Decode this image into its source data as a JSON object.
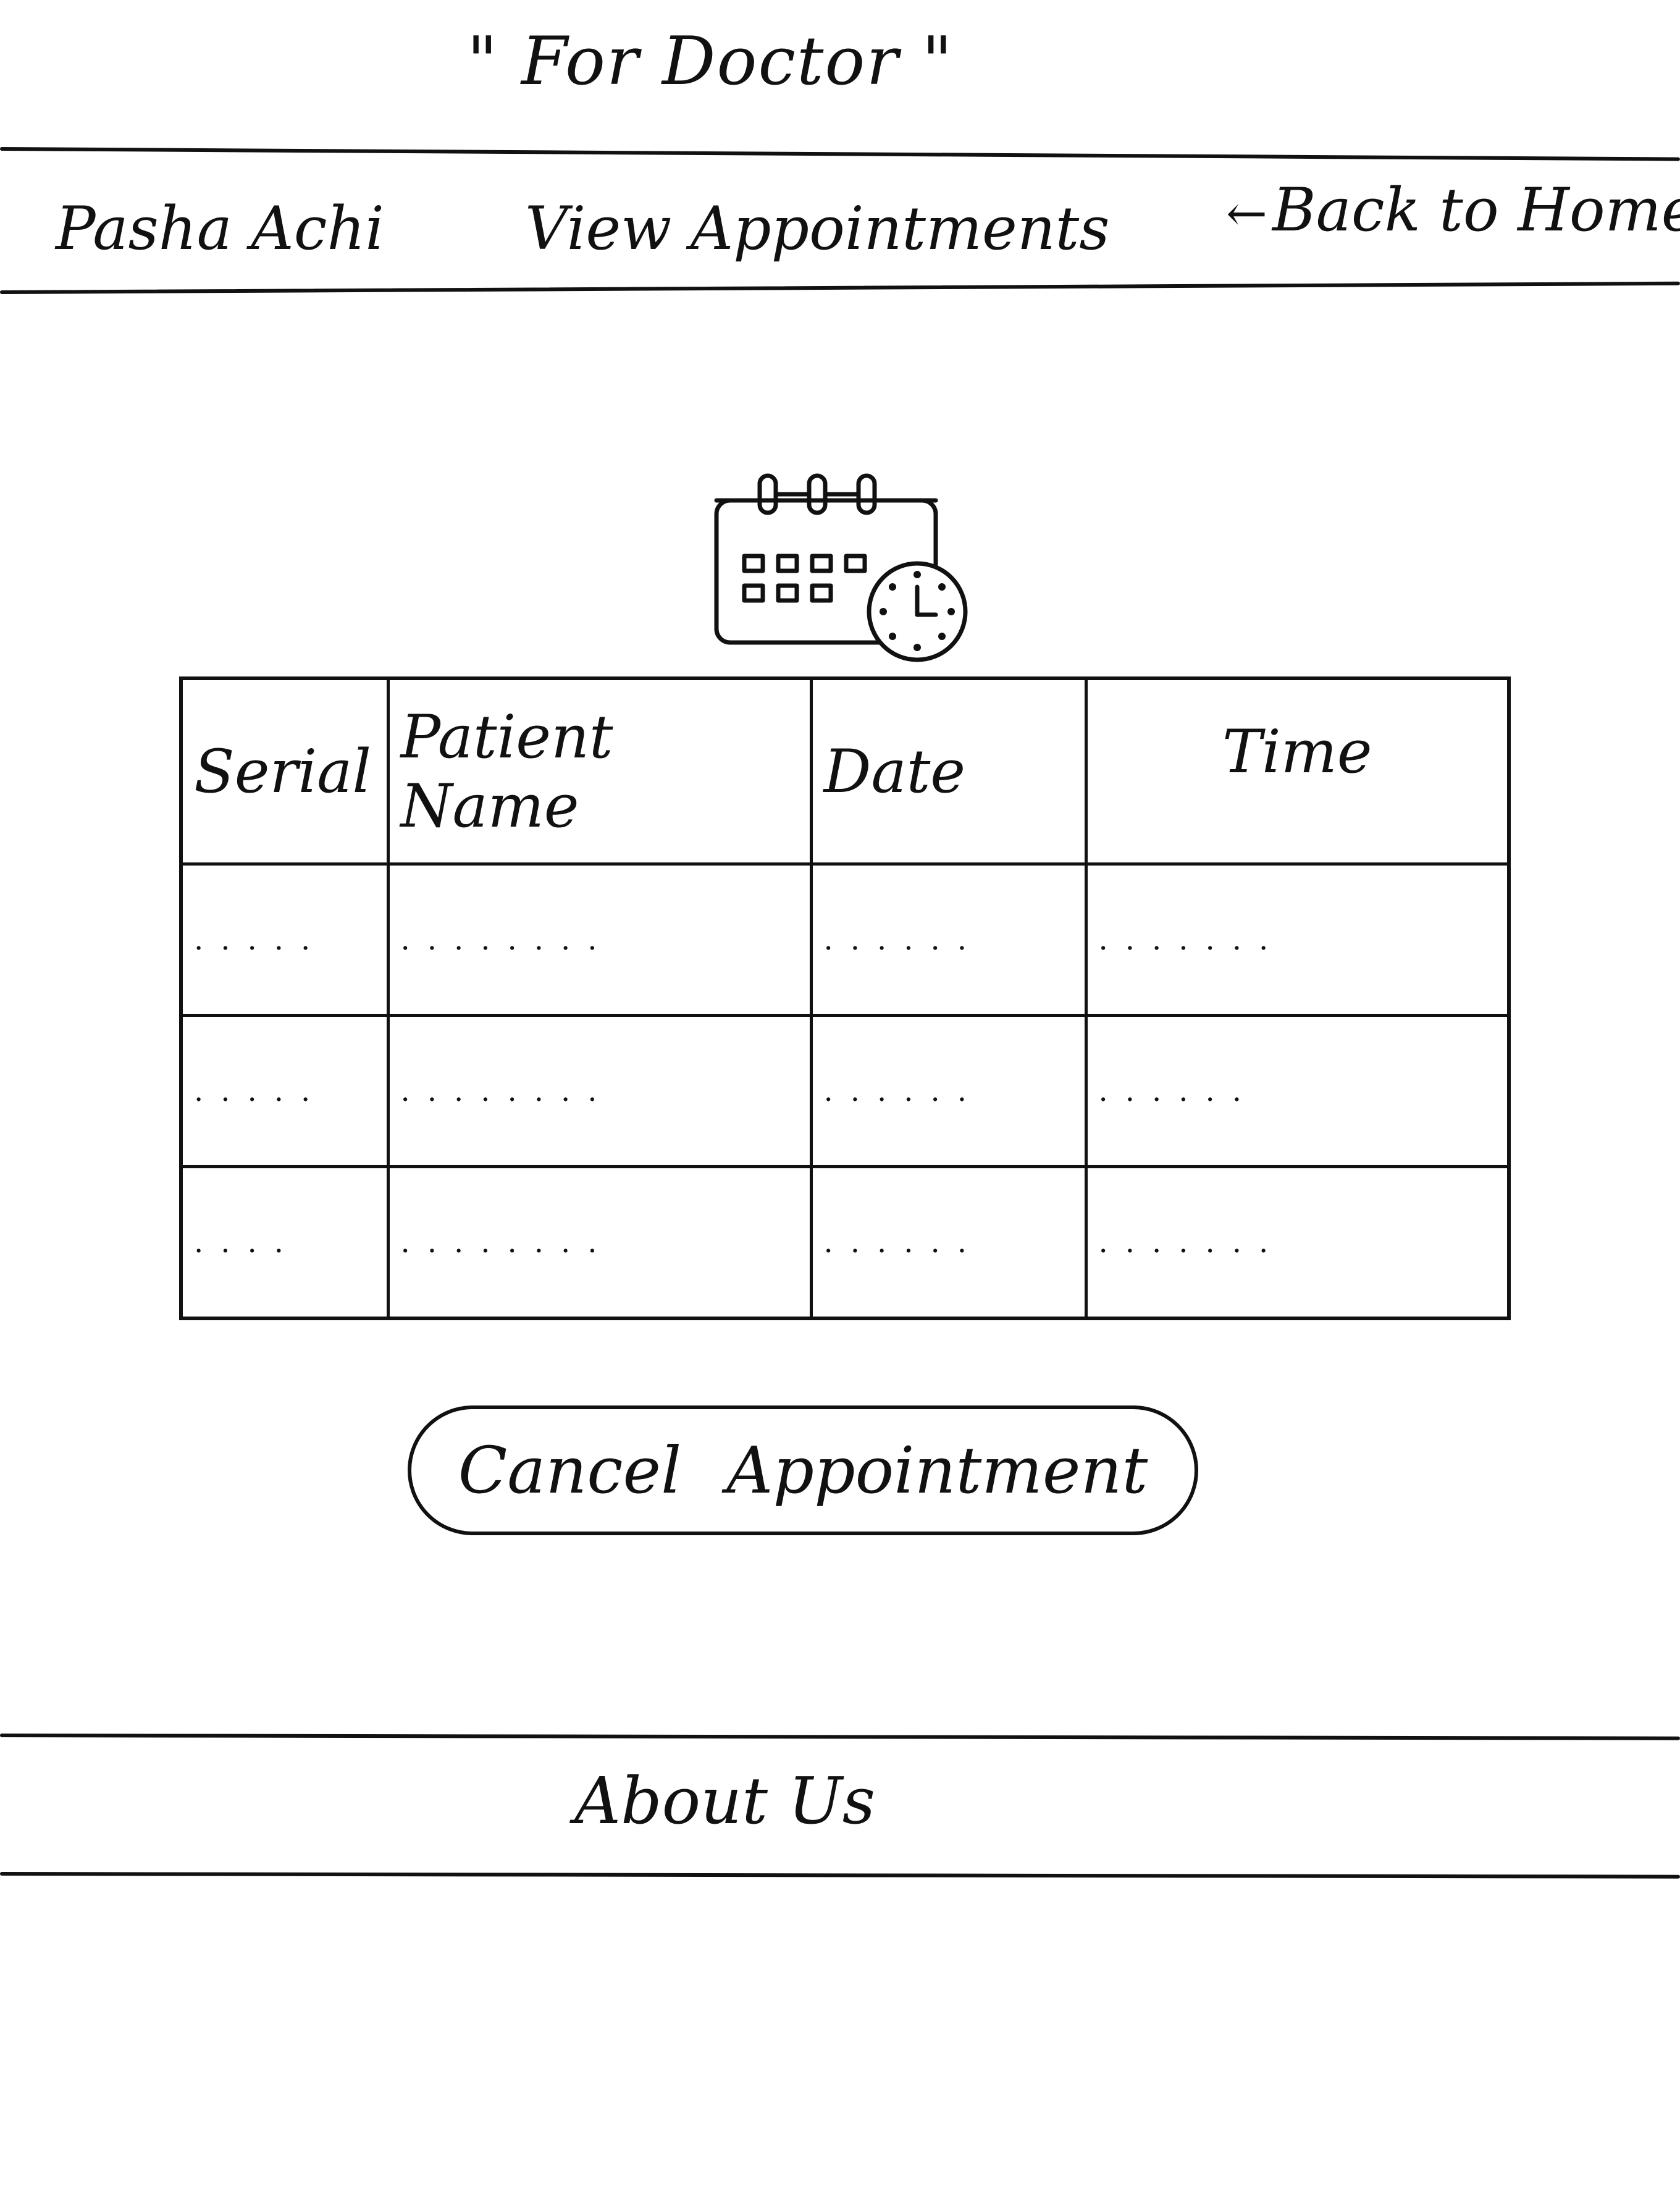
{
  "caption": "\" For Doctor \"",
  "nav": {
    "brand": "Pasha Achi",
    "view_appointments": "View Appointments",
    "back_to_home": "Back to Home",
    "back_arrow": "←"
  },
  "calendar_icon": "calendar-clock-icon",
  "table": {
    "headers": [
      "Serial",
      "Patient Name",
      "Date",
      "Time"
    ],
    "rows": [
      [
        ".....",
        "........",
        "......",
        "......."
      ],
      [
        ".....",
        "........",
        "......",
        "......"
      ],
      [
        "....",
        "........",
        "......",
        "......."
      ]
    ]
  },
  "cancel_button": "Cancel Appointment",
  "footer": {
    "about_us": "About Us"
  }
}
